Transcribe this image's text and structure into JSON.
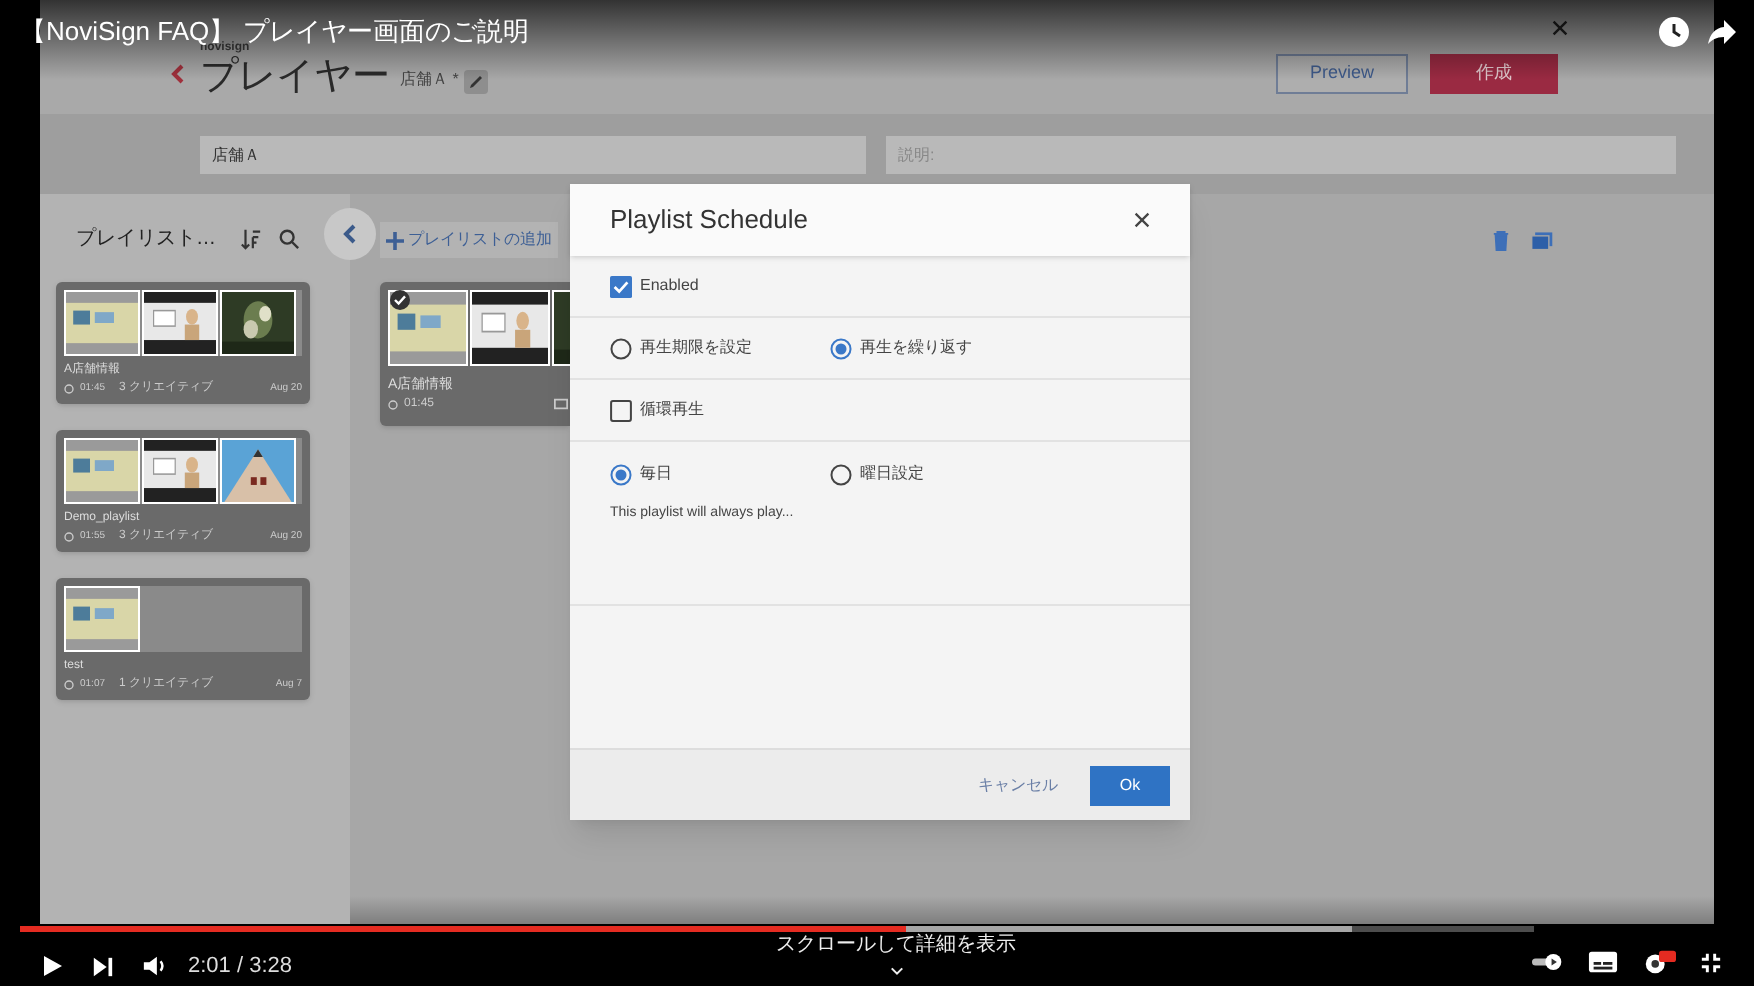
{
  "video": {
    "title": "【NoviSign FAQ】 プレイヤー画面のご説明",
    "time": "2:01 / 3:28",
    "progress": {
      "level": 0.585
    },
    "buffered": {
      "level": 0.88
    },
    "scroll_hint": "スクロールして詳細を表示"
  },
  "app": {
    "logo": "novisign",
    "header": {
      "title": "プレイヤー",
      "subtitle": "店舗Ａ *",
      "buttons": [
        {
          "label": "Preview",
          "kind": "outline"
        },
        {
          "label": "作成",
          "kind": "primary"
        }
      ]
    },
    "fields": [
      {
        "value": "店舗Ａ"
      },
      {
        "placeholder": "説明:"
      }
    ],
    "sidebar": {
      "title": "プレイリスト…",
      "playlists": [
        {
          "name": "A店舗情報",
          "duration": "01:45",
          "creatives": "3 クリエイティブ",
          "date": "Aug 20"
        },
        {
          "name": "Demo_playlist",
          "duration": "01:55",
          "creatives": "3 クリエイティブ",
          "date": "Aug 20"
        },
        {
          "name": "test",
          "duration": "01:07",
          "creatives": "1 クリエイティブ",
          "date": "Aug 7"
        }
      ]
    },
    "main": {
      "add_button": "プレイリストの追加",
      "cards": [
        {
          "name": "A店舗情報",
          "duration": "01:45",
          "selected": true
        }
      ]
    }
  },
  "dialog": {
    "title": "Playlist Schedule",
    "rows": [
      {
        "kind": "checkbox",
        "label": "Enabled",
        "checked": true
      },
      {
        "kind": "radio",
        "options": [
          {
            "label": "再生期限を設定",
            "selected": false
          },
          {
            "label": "再生を繰り返す",
            "selected": true
          }
        ]
      },
      {
        "kind": "checkbox",
        "label": "循環再生",
        "checked": false
      },
      {
        "kind": "radio",
        "options": [
          {
            "label": "毎日",
            "selected": true
          },
          {
            "label": "曜日設定",
            "selected": false
          }
        ],
        "note": "This playlist will always play..."
      }
    ],
    "cancel": "キャンセル",
    "ok": "Ok"
  }
}
